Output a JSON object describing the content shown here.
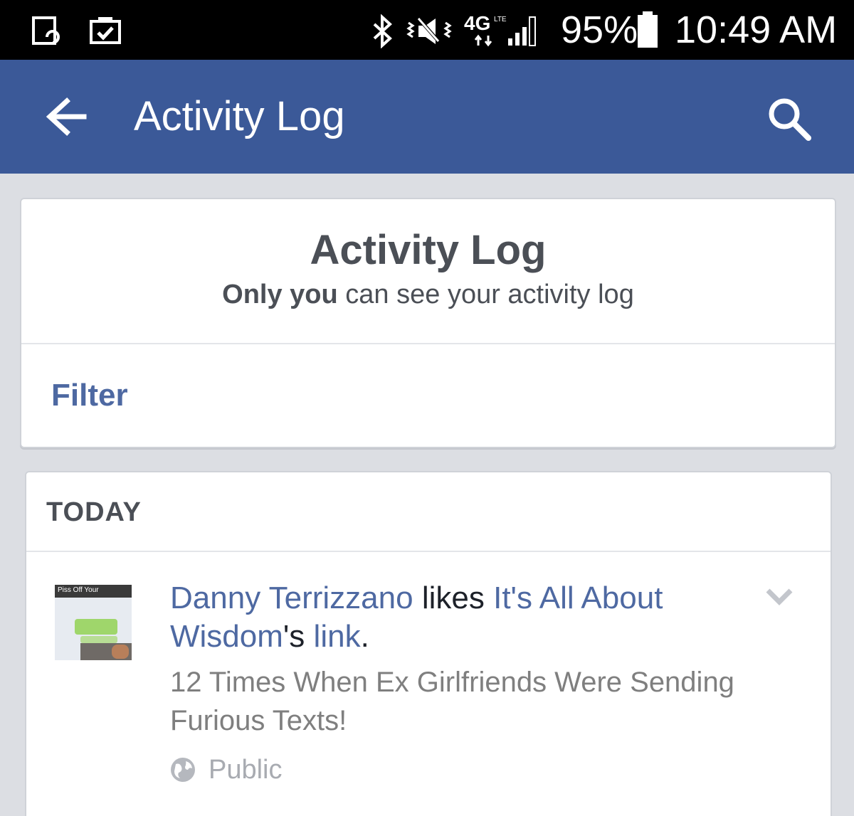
{
  "status_bar": {
    "icons": [
      "screen-rotate-icon",
      "clipboard-check-icon",
      "bluetooth-icon",
      "vibrate-icon",
      "lte-icon",
      "signal-icon",
      "battery-icon"
    ],
    "network": "4G",
    "network_sub": "LTE",
    "battery": "95%",
    "time": "10:49 AM"
  },
  "app_bar": {
    "title": "Activity Log",
    "back_icon": "arrow-left-icon",
    "search_icon": "search-icon",
    "background": "#3b5998"
  },
  "header_card": {
    "title": "Activity Log",
    "subtitle_bold": "Only you",
    "subtitle_rest": "can see your activity log",
    "filter_label": "Filter"
  },
  "activity": {
    "section_label": "TODAY",
    "items": [
      {
        "thumbnail_caption": "Piss Off Your",
        "actor": "Danny Terrizzano",
        "verb": "likes",
        "page": "It's All About Wisdom",
        "possessive": "'s",
        "object": "link",
        "period": ".",
        "description": "12 Times When Ex Girlfriends Were Sending Furious Texts!",
        "privacy": "Public",
        "privacy_icon": "globe-icon",
        "menu_icon": "chevron-down-icon"
      }
    ]
  },
  "colors": {
    "link": "#4e69a2",
    "text_dark": "#4b4f56",
    "page_bg": "#dcdee3"
  }
}
